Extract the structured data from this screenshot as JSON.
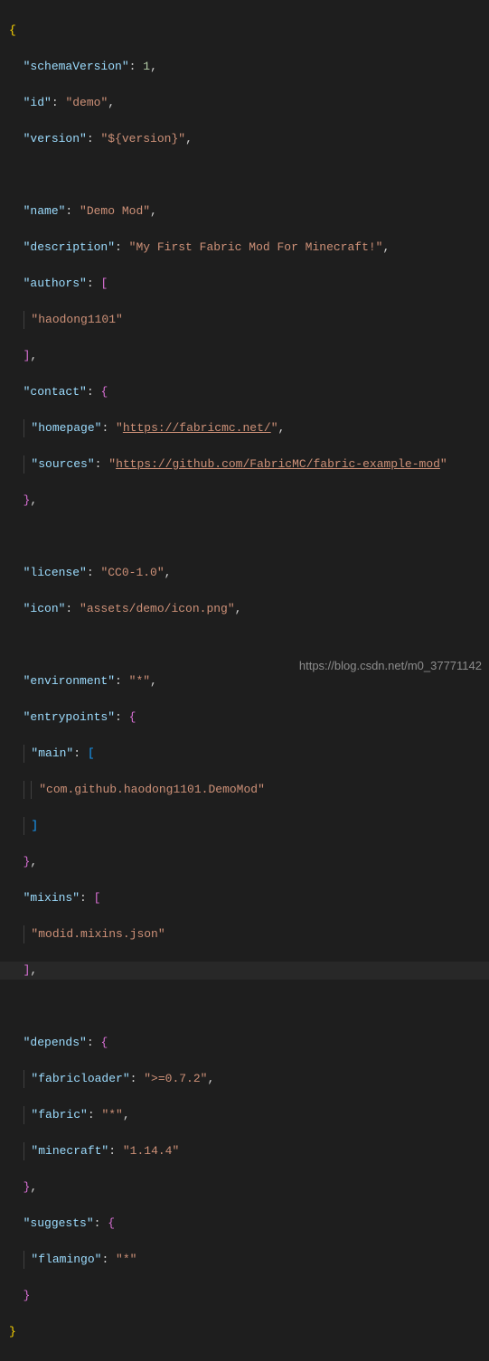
{
  "json": {
    "schemaVersion_key": "\"schemaVersion\"",
    "schemaVersion_val": "1",
    "id_key": "\"id\"",
    "id_val": "\"demo\"",
    "version_key": "\"version\"",
    "version_val": "\"${version}\"",
    "name_key": "\"name\"",
    "name_val": "\"Demo Mod\"",
    "description_key": "\"description\"",
    "description_val": "\"My First Fabric Mod For Minecraft!\"",
    "authors_key": "\"authors\"",
    "authors_item0": "\"haodong1101\"",
    "contact_key": "\"contact\"",
    "homepage_key": "\"homepage\"",
    "homepage_val_q1": "\"",
    "homepage_val_link": "https://fabricmc.net/",
    "homepage_val_q2": "\"",
    "sources_key": "\"sources\"",
    "sources_val_q1": "\"",
    "sources_val_link": "https://github.com/FabricMC/fabric-example-mod",
    "sources_val_q2": "\"",
    "license_key": "\"license\"",
    "license_val": "\"CC0-1.0\"",
    "icon_key": "\"icon\"",
    "icon_val": "\"assets/demo/icon.png\"",
    "environment_key": "\"environment\"",
    "environment_val": "\"*\"",
    "entrypoints_key": "\"entrypoints\"",
    "main_key": "\"main\"",
    "main_item0": "\"com.github.haodong1101.DemoMod\"",
    "mixins_key": "\"mixins\"",
    "mixins_item0": "\"modid.mixins.json\"",
    "depends_key": "\"depends\"",
    "fabricloader_key": "\"fabricloader\"",
    "fabricloader_val": "\">=0.7.2\"",
    "fabric_key": "\"fabric\"",
    "fabric_val": "\"*\"",
    "minecraft_key": "\"minecraft\"",
    "minecraft_val": "\"1.14.4\"",
    "suggests_key": "\"suggests\"",
    "flamingo_key": "\"flamingo\"",
    "flamingo_val": "\"*\""
  },
  "watermark": "https://blog.csdn.net/m0_37771142"
}
